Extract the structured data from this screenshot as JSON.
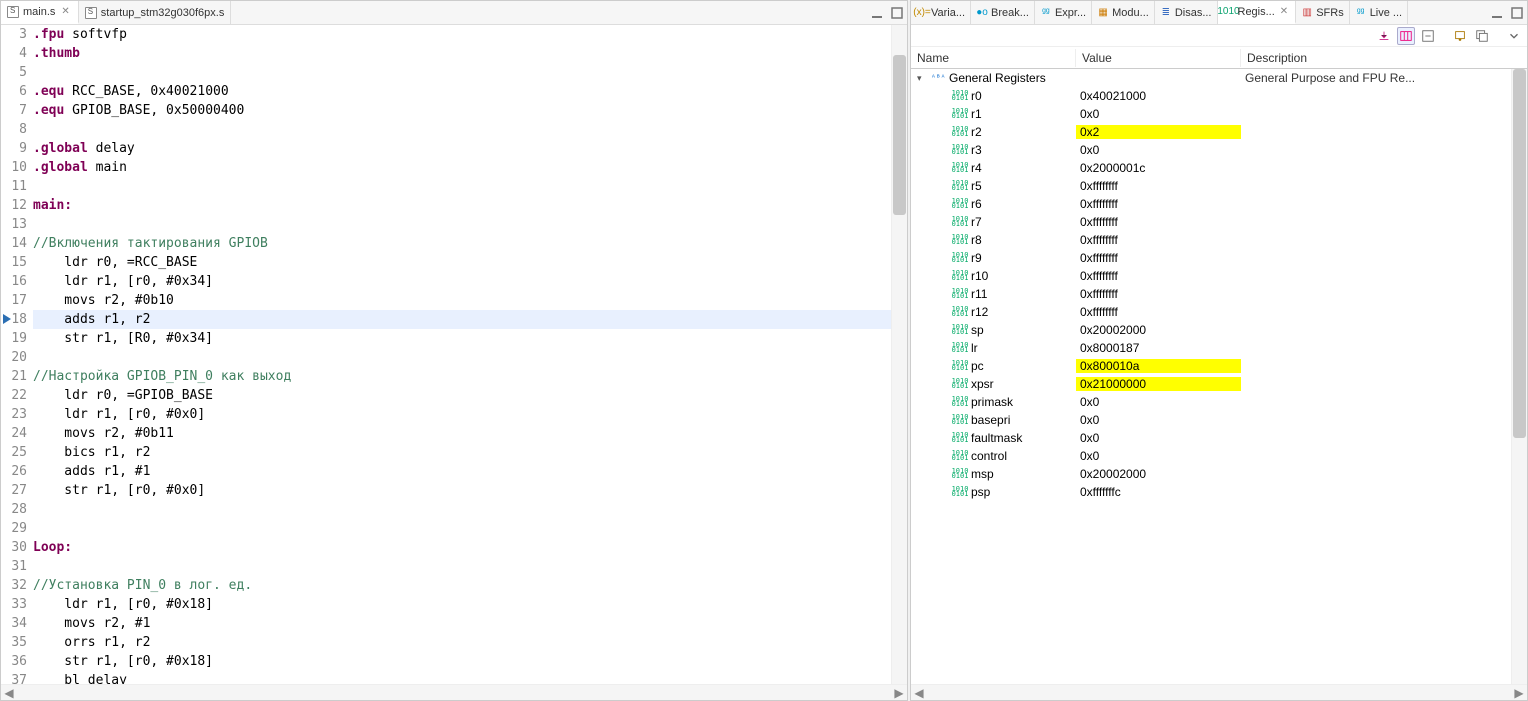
{
  "editor": {
    "tabs": [
      {
        "label": "main.s",
        "active": true
      },
      {
        "label": "startup_stm32g030f6px.s",
        "active": false
      }
    ],
    "current_line": 18,
    "lines": [
      {
        "n": 3,
        "html": "<span class='kw-dir'>.fpu</span> softvfp"
      },
      {
        "n": 4,
        "html": "<span class='kw-dir'>.thumb</span>"
      },
      {
        "n": 5,
        "html": ""
      },
      {
        "n": 6,
        "html": "<span class='kw-dir'>.equ</span> RCC_BASE, 0x40021000"
      },
      {
        "n": 7,
        "html": "<span class='kw-dir'>.equ</span> GPIOB_BASE, 0x50000400"
      },
      {
        "n": 8,
        "html": ""
      },
      {
        "n": 9,
        "html": "<span class='kw-dir'>.global</span> delay"
      },
      {
        "n": 10,
        "html": "<span class='kw-dir'>.global</span> main"
      },
      {
        "n": 11,
        "html": ""
      },
      {
        "n": 12,
        "html": "<span class='kw-label'>main:</span>"
      },
      {
        "n": 13,
        "html": ""
      },
      {
        "n": 14,
        "html": "<span class='cmt'>//Включения тактирования GPIOB</span>"
      },
      {
        "n": 15,
        "html": "    ldr r0, =RCC_BASE"
      },
      {
        "n": 16,
        "html": "    ldr r1, [r0, #0x34]"
      },
      {
        "n": 17,
        "html": "    movs r2, #0b10"
      },
      {
        "n": 18,
        "html": "    adds r1, r2"
      },
      {
        "n": 19,
        "html": "    str r1, [R0, #0x34]"
      },
      {
        "n": 20,
        "html": ""
      },
      {
        "n": 21,
        "html": "<span class='cmt'>//Настройка GPIOB_PIN_0 как выход</span>"
      },
      {
        "n": 22,
        "html": "    ldr r0, =GPIOB_BASE"
      },
      {
        "n": 23,
        "html": "    ldr r1, [r0, #0x0]"
      },
      {
        "n": 24,
        "html": "    movs r2, #0b11"
      },
      {
        "n": 25,
        "html": "    bics r1, r2"
      },
      {
        "n": 26,
        "html": "    adds r1, #1"
      },
      {
        "n": 27,
        "html": "    str r1, [r0, #0x0]"
      },
      {
        "n": 28,
        "html": ""
      },
      {
        "n": 29,
        "html": ""
      },
      {
        "n": 30,
        "html": "<span class='kw-label'>Loop:</span>"
      },
      {
        "n": 31,
        "html": ""
      },
      {
        "n": 32,
        "html": "<span class='cmt'>//Установка PIN_0 в лог. ед.</span>"
      },
      {
        "n": 33,
        "html": "    ldr r1, [r0, #0x18]"
      },
      {
        "n": 34,
        "html": "    movs r2, #1"
      },
      {
        "n": 35,
        "html": "    orrs r1, r2"
      },
      {
        "n": 36,
        "html": "    str r1, [r0, #0x18]"
      },
      {
        "n": 37,
        "html": "    bl delay"
      }
    ]
  },
  "right": {
    "tabs": [
      {
        "label": "Varia...",
        "icon": "var",
        "color": "#c28a00"
      },
      {
        "label": "Break...",
        "icon": "brk",
        "color": "#0099cc"
      },
      {
        "label": "Expr...",
        "icon": "expr",
        "color": "#0099cc"
      },
      {
        "label": "Modu...",
        "icon": "mod",
        "color": "#cc7a00"
      },
      {
        "label": "Disas...",
        "icon": "dis",
        "color": "#3a6ec2"
      },
      {
        "label": "Regis...",
        "icon": "reg",
        "color": "#0aa36f",
        "active": true,
        "close": true
      },
      {
        "label": "SFRs",
        "icon": "sfr",
        "color": "#cc3333"
      },
      {
        "label": "Live ...",
        "icon": "live",
        "color": "#0099cc"
      }
    ],
    "headers": {
      "name": "Name",
      "value": "Value",
      "desc": "Description"
    },
    "group": {
      "label": "General Registers",
      "desc": "General Purpose and FPU Re..."
    },
    "registers": [
      {
        "name": "r0",
        "value": "0x40021000",
        "hl": false
      },
      {
        "name": "r1",
        "value": "0x0",
        "hl": false
      },
      {
        "name": "r2",
        "value": "0x2",
        "hl": true
      },
      {
        "name": "r3",
        "value": "0x0",
        "hl": false
      },
      {
        "name": "r4",
        "value": "0x2000001c",
        "hl": false
      },
      {
        "name": "r5",
        "value": "0xffffffff",
        "hl": false
      },
      {
        "name": "r6",
        "value": "0xffffffff",
        "hl": false
      },
      {
        "name": "r7",
        "value": "0xffffffff",
        "hl": false
      },
      {
        "name": "r8",
        "value": "0xffffffff",
        "hl": false
      },
      {
        "name": "r9",
        "value": "0xffffffff",
        "hl": false
      },
      {
        "name": "r10",
        "value": "0xffffffff",
        "hl": false
      },
      {
        "name": "r11",
        "value": "0xffffffff",
        "hl": false
      },
      {
        "name": "r12",
        "value": "0xffffffff",
        "hl": false
      },
      {
        "name": "sp",
        "value": "0x20002000",
        "hl": false
      },
      {
        "name": "lr",
        "value": "0x8000187",
        "hl": false
      },
      {
        "name": "pc",
        "value": "0x800010a",
        "hl": true
      },
      {
        "name": "xpsr",
        "value": "0x21000000",
        "hl": true
      },
      {
        "name": "primask",
        "value": "0x0",
        "hl": false
      },
      {
        "name": "basepri",
        "value": "0x0",
        "hl": false
      },
      {
        "name": "faultmask",
        "value": "0x0",
        "hl": false
      },
      {
        "name": "control",
        "value": "0x0",
        "hl": false
      },
      {
        "name": "msp",
        "value": "0x20002000",
        "hl": false
      },
      {
        "name": "psp",
        "value": "0xfffffffc",
        "hl": false
      }
    ]
  }
}
